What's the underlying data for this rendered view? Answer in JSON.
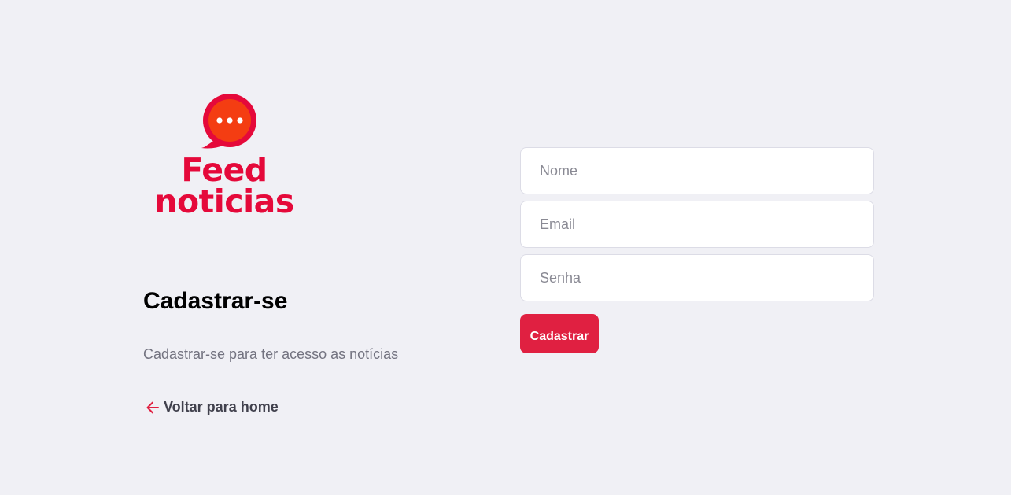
{
  "brand": {
    "name_line1": "Feed",
    "name_line2": "noticias",
    "color": "#e5093a",
    "icon": "speech-bubble-ellipsis-icon"
  },
  "intro": {
    "title": "Cadastrar-se",
    "subtitle": "Cadastrar-se para ter acesso as notícias",
    "back_link": "Voltar para home",
    "back_icon": "arrow-left-icon"
  },
  "form": {
    "name_placeholder": "Nome",
    "email_placeholder": "Email",
    "password_placeholder": "Senha",
    "submit_label": "Cadastrar",
    "accent_color": "#e02041"
  }
}
